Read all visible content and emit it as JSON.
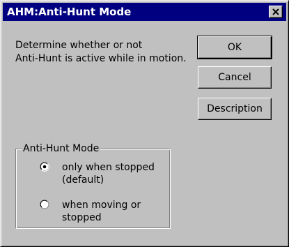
{
  "window": {
    "title": "AHM:Anti-Hunt Mode",
    "close_icon": "close-icon"
  },
  "description": {
    "line1": "Determine whether or not",
    "line2": "Anti-Hunt is active while in motion."
  },
  "buttons": {
    "ok": "OK",
    "cancel": "Cancel",
    "description": "Description"
  },
  "group": {
    "title": "Anti-Hunt Mode",
    "options": [
      {
        "line1": "only when stopped",
        "line2": "(default)",
        "selected": true
      },
      {
        "line1": "when moving or",
        "line2": "stopped",
        "selected": false
      }
    ]
  },
  "colors": {
    "titlebar": "#000080",
    "face": "#c0c0c0"
  }
}
